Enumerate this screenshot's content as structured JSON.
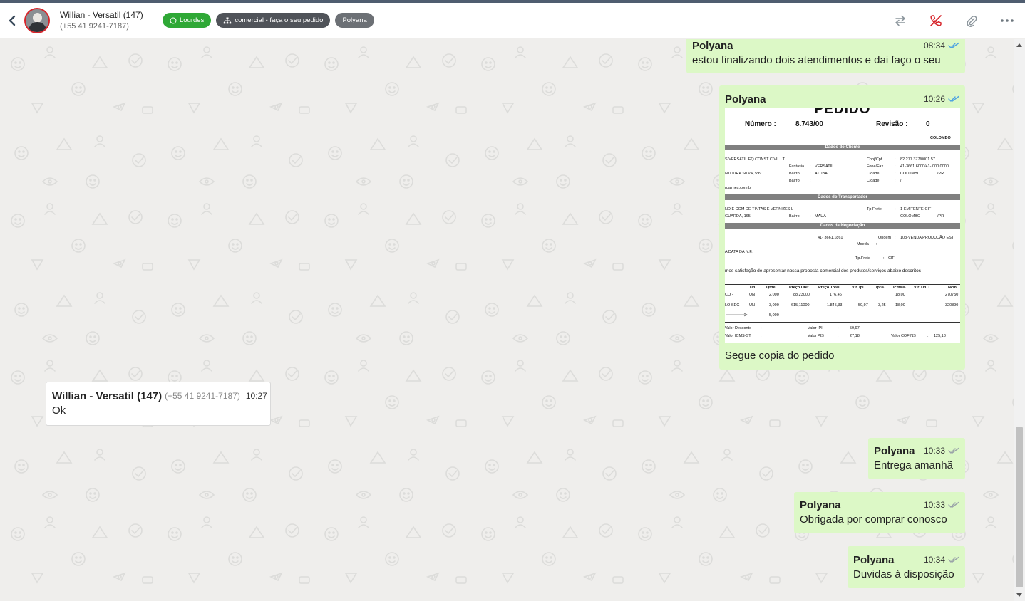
{
  "header": {
    "contact_name": "Willian - Versatil (147)",
    "contact_phone": "(+55 41 9241-7187)",
    "tags": [
      {
        "label": "Lourdes",
        "icon": "whatsapp-icon",
        "color": "#2fa836"
      },
      {
        "label": "comercial - faça o seu pedido",
        "icon": "org-chart-icon",
        "color": "#505359"
      },
      {
        "label": "Polyana",
        "icon": "",
        "color": "#6c7075"
      }
    ]
  },
  "messages": [
    {
      "direction": "out",
      "sender": "Polyana",
      "time": "08:34",
      "status": "read",
      "text": "estou finalizando dois atendimentos e dai faço o seu"
    },
    {
      "direction": "out",
      "sender": "Polyana",
      "time": "10:26",
      "status": "read",
      "caption": "Segue copia do pedido",
      "document": {
        "title": "PEDIDO",
        "numero_label": "Número :",
        "numero": "8.743/00",
        "revisao_label": "Revisão :",
        "revisao": "0",
        "city": "COLOMBO",
        "sections": [
          "Dados do Cliente",
          "Dados do Transportador",
          "Dados da Negociação"
        ],
        "client_lines": [
          "S VERSATIL EQ CONST CIVIL LT",
          "Cnpj/Cpf",
          ":",
          "82.277.377/0001.57",
          "Fantasia",
          ":",
          "VERSATIL",
          "Fone/Fax",
          ":",
          "41-3661.6000/41- 000.0000",
          "NTOURA SILVA, 599",
          "Bairro",
          ":",
          "ATUBA",
          "Cidade",
          ":",
          "COLOMBO",
          "/PR",
          "Bairro",
          ":",
          "Cidade",
          ":",
          "/",
          "rdaimes.com.br"
        ],
        "transport_lines": [
          "ND E COM DE TINTAS E VERNIZES L",
          "Tp Frete",
          ":",
          "1-EMITENTE-CIF",
          "GUARDA, 165",
          "Bairro",
          ":",
          "MAUA",
          "COLOMBO",
          "/PR"
        ],
        "negotiation_lines": [
          "41- 3661.1861",
          "Origem",
          ":",
          "103-VENDA PRODUÇÃO EST.",
          "Moeda",
          ":",
          "-",
          "A DATA DA N.F.",
          "Tp.Frete",
          ":",
          "CIF"
        ],
        "proposal_text": "mos satisfação de apresentar nossa proposta comercial dos produtos/serviços abaixo descritos",
        "table_headers": [
          "Un",
          "Qtde",
          "Preço Unit",
          "Preço Total",
          "Vlr. Ipi",
          "Ipi%",
          "Icms%",
          "Vlr. Un. L.",
          "Ncm"
        ],
        "rows": [
          [
            "CO -",
            "UN",
            "2,000",
            "88,23000",
            "176,46",
            "",
            "",
            "18,00",
            "",
            "270750"
          ],
          [
            "LO SEG",
            "UN",
            "3,000",
            "615,11000",
            "1.845,33",
            "59,97",
            "3,25",
            "18,00",
            "",
            "320890"
          ],
          [
            "",
            "",
            "5,000",
            "",
            "",
            "",
            "",
            "",
            "",
            ""
          ]
        ],
        "totals": [
          "Valor Desconto",
          ":",
          "Valor IPI",
          ":",
          "59,97",
          "Valor ICMS-ST",
          ":",
          "Valor PIS",
          ":",
          "27,18",
          "Valor COFINS",
          ":",
          "125,18"
        ]
      }
    },
    {
      "direction": "in",
      "sender": "Willian - Versatil (147)",
      "phone": "(+55 41 9241-7187)",
      "time": "10:27",
      "text": "Ok"
    },
    {
      "direction": "out",
      "sender": "Polyana",
      "time": "10:33",
      "status": "delivered",
      "text": "Entrega amanhã"
    },
    {
      "direction": "out",
      "sender": "Polyana",
      "time": "10:33",
      "status": "delivered",
      "text": "Obrigada por comprar conosco"
    },
    {
      "direction": "out",
      "sender": "Polyana",
      "time": "10:34",
      "status": "delivered",
      "text": "Duvidas à disposição"
    }
  ],
  "colors": {
    "outgoing_bubble": "#dcf8c6",
    "incoming_bubble": "#ffffff",
    "read_tick": "#4fa3e0",
    "delivered_tick": "#9aa3a8",
    "accent_red": "#d7262c"
  }
}
